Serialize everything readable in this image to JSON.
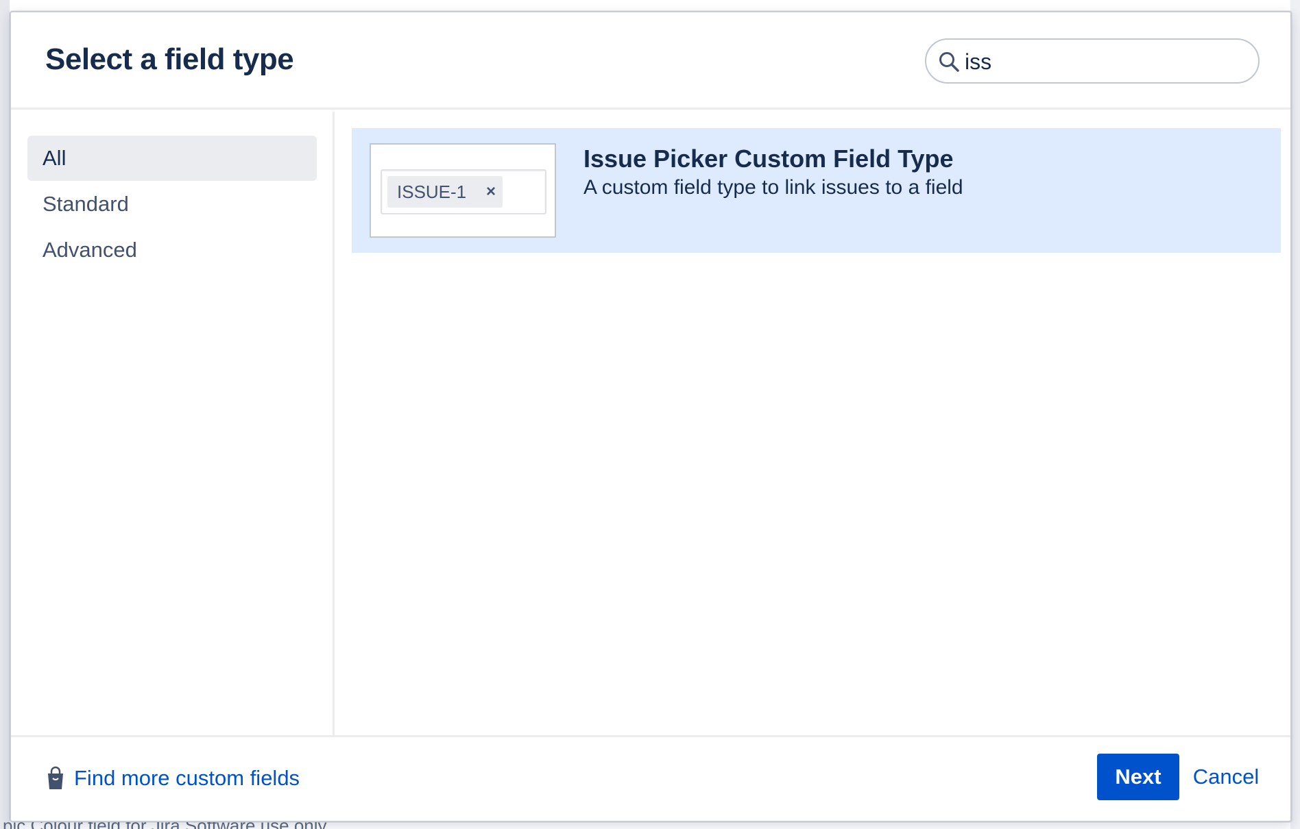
{
  "dialog": {
    "title": "Select a field type"
  },
  "search": {
    "value": "iss",
    "placeholder": ""
  },
  "sidebar": {
    "items": [
      {
        "label": "All",
        "active": true
      },
      {
        "label": "Standard",
        "active": false
      },
      {
        "label": "Advanced",
        "active": false
      }
    ]
  },
  "results": [
    {
      "name": "Issue Picker Custom Field Type",
      "description": "A custom field type to link issues to a field",
      "preview_tag": "ISSUE-1",
      "preview_close": "×",
      "selected": true
    }
  ],
  "footer": {
    "find_more_label": "Find more custom fields",
    "next_label": "Next",
    "cancel_label": "Cancel"
  },
  "backdrop": {
    "partial_text": "pic Colour field for Jira Software use only"
  },
  "colors": {
    "primary": "#0052cc",
    "selected_bg": "#deebff",
    "active_nav_bg": "#ebecf0",
    "text": "#172b4d"
  },
  "icons": {
    "search": "search-icon",
    "marketplace": "shopping-bag-icon"
  }
}
